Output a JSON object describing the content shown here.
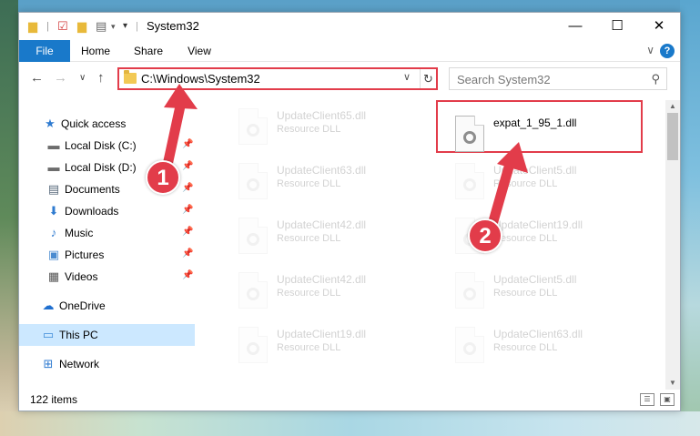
{
  "window": {
    "title": "System32",
    "minimize": "—",
    "maximize": "☐",
    "close": "✕"
  },
  "ribbon": {
    "tabs": [
      "File",
      "Home",
      "Share",
      "View"
    ],
    "help": "?",
    "collapse": "∨"
  },
  "nav": {
    "back": "←",
    "forward": "→",
    "recent": "∨",
    "up": "↑",
    "address": "C:\\Windows\\System32",
    "address_dropdown": "∨",
    "refresh": "↻",
    "search_placeholder": "Search System32",
    "search_icon": "⚲"
  },
  "sidebar": {
    "items": [
      {
        "label": "Quick access",
        "icon": "star-icon",
        "glyph": "★",
        "color": "#2f7bd0"
      },
      {
        "label": "Local Disk (C:)",
        "icon": "drive-icon",
        "glyph": "▬",
        "color": "#6d6d6d",
        "pinned": true
      },
      {
        "label": "Local Disk (D:)",
        "icon": "drive-icon",
        "glyph": "▬",
        "color": "#6d6d6d",
        "pinned": true
      },
      {
        "label": "Documents",
        "icon": "documents-icon",
        "glyph": "▤",
        "color": "#5a6b7d",
        "pinned": true
      },
      {
        "label": "Downloads",
        "icon": "download-icon",
        "glyph": "⬇",
        "color": "#2f7bd0",
        "pinned": true
      },
      {
        "label": "Music",
        "icon": "music-icon",
        "glyph": "♪",
        "color": "#2f7bd0",
        "pinned": true
      },
      {
        "label": "Pictures",
        "icon": "pictures-icon",
        "glyph": "▣",
        "color": "#4a8bd0",
        "pinned": true
      },
      {
        "label": "Videos",
        "icon": "videos-icon",
        "glyph": "▦",
        "color": "#555555",
        "pinned": true
      },
      {
        "label": "OneDrive",
        "icon": "cloud-icon",
        "glyph": "☁",
        "color": "#1f6fcf"
      },
      {
        "label": "This PC",
        "icon": "computer-icon",
        "glyph": "▭",
        "color": "#3c8ad8",
        "selected": true
      },
      {
        "label": "Network",
        "icon": "network-icon",
        "glyph": "⊞",
        "color": "#2f7bd0"
      }
    ],
    "pin_glyph": "📌"
  },
  "files": {
    "left_column": [
      {
        "name": "UpdateClient65.dll",
        "type": "Resource DLL"
      },
      {
        "name": "UpdateClient63.dll",
        "type": "Resource DLL"
      },
      {
        "name": "UpdateClient42.dll",
        "type": "Resource DLL"
      },
      {
        "name": "UpdateClient42.dll",
        "type": "Resource DLL"
      },
      {
        "name": "UpdateClient19.dll",
        "type": "Resource DLL"
      }
    ],
    "right_column": [
      {
        "name": "expat_1_95_1.dll",
        "type": "",
        "main": true
      },
      {
        "name": "UpdateClient5.dll",
        "type": "Resource DLL"
      },
      {
        "name": "UpdateClient19.dll",
        "type": "Resource DLL"
      },
      {
        "name": "UpdateClient5.dll",
        "type": "Resource DLL"
      },
      {
        "name": "UpdateClient63.dll",
        "type": "Resource DLL"
      }
    ]
  },
  "scrollbar": {
    "up": "▲",
    "down": "▼"
  },
  "status": {
    "item_count": "122 items",
    "details_view": "☰",
    "icons_view": "▣"
  },
  "annotations": {
    "step1": "1",
    "step2": "2",
    "accent_color": "#e23c4a"
  }
}
